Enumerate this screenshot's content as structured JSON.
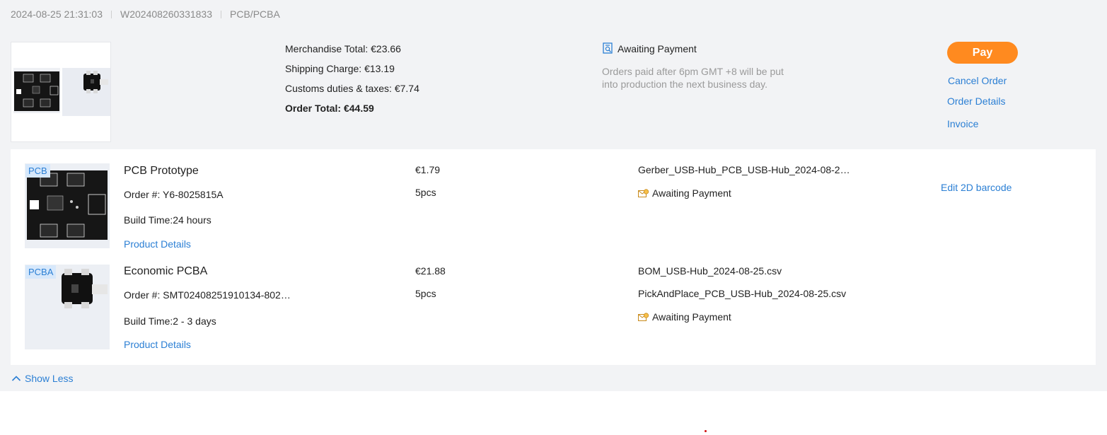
{
  "header": {
    "date": "2024-08-25 21:31:03",
    "order_no": "W202408260331833",
    "category": "PCB/PCBA"
  },
  "summary": {
    "merchandise_total": "Merchandise Total: €23.66",
    "shipping_charge": "Shipping Charge: €13.19",
    "customs": "Customs duties & taxes: €7.74",
    "order_total": "Order Total: €44.59"
  },
  "status": {
    "icon": "search-doc-icon",
    "label": "Awaiting Payment",
    "note": "Orders paid after 6pm GMT +8 will be put into production the next business day."
  },
  "actions": {
    "pay": "Pay",
    "cancel": "Cancel Order",
    "details": "Order Details",
    "invoice": "Invoice"
  },
  "items": [
    {
      "tag": "PCB",
      "title": "PCB Prototype",
      "order": "Order #: Y6-8025815A",
      "build": "Build Time:24 hours",
      "details_link": "Product Details",
      "price": "€1.79",
      "qty": "5pcs",
      "files": [
        "Gerber_USB-Hub_PCB_USB-Hub_2024-08-2…"
      ],
      "status": "Awaiting Payment",
      "extra_link": "Edit 2D barcode"
    },
    {
      "tag": "PCBA",
      "title": "Economic PCBA",
      "order": "Order #: SMT02408251910134-802…",
      "build": "Build Time:2 - 3 days",
      "details_link": "Product Details",
      "price": "€21.88",
      "qty": "5pcs",
      "files": [
        "BOM_USB-Hub_2024-08-25.csv",
        "PickAndPlace_PCB_USB-Hub_2024-08-25.csv"
      ],
      "status": "Awaiting Payment"
    }
  ],
  "footer": {
    "show_less": "Show Less"
  },
  "colors": {
    "accent": "#2b7fd4",
    "pay": "#ff8a1f",
    "background": "#f2f3f5"
  }
}
